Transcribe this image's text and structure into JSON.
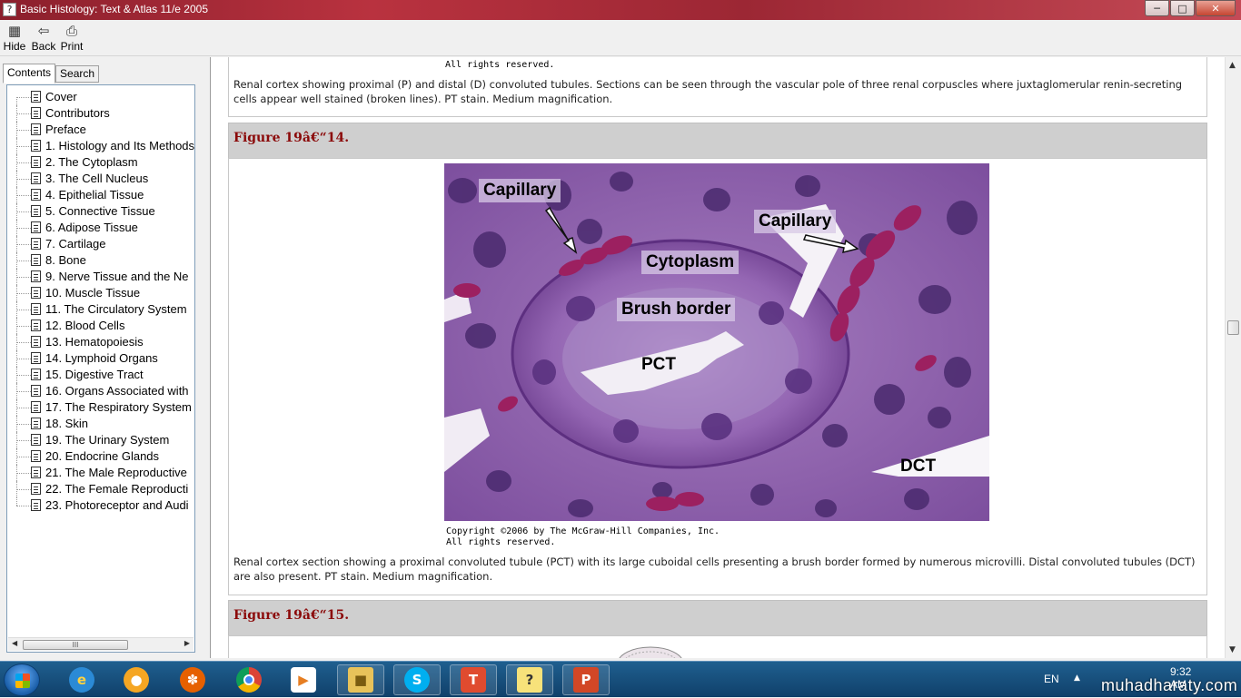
{
  "window": {
    "title": "Basic Histology: Text & Atlas 11/e 2005",
    "buttons": {
      "minimize": "─",
      "maximize": "□",
      "close": "✕"
    }
  },
  "toolbar": {
    "hide_label": "Hide",
    "back_label": "Back",
    "print_label": "Print"
  },
  "nav": {
    "tabs": [
      "Contents",
      "Search"
    ],
    "items": [
      "Cover",
      "Contributors",
      "Preface",
      "1. Histology and Its Methods",
      "2. The Cytoplasm",
      "3. The Cell Nucleus",
      "4. Epithelial Tissue",
      "5. Connective Tissue",
      "6. Adipose Tissue",
      "7. Cartilage",
      "8. Bone",
      "9. Nerve Tissue and the Ne",
      "10. Muscle Tissue",
      "11. The Circulatory System",
      "12. Blood Cells",
      "13. Hematopoiesis",
      "14. Lymphoid Organs",
      "15. Digestive Tract",
      "16. Organs Associated with",
      "17. The Respiratory System",
      "18. Skin",
      "19. The Urinary System",
      "20. Endocrine Glands",
      "21. The Male Reproductive",
      "22. The Female Reproducti",
      "23. Photoreceptor and Audi"
    ],
    "scroll_thumb": "III"
  },
  "content": {
    "prev_figure": {
      "copyright_line2": "All rights reserved.",
      "caption": "Renal cortex showing proximal (P) and distal (D) convoluted tubules. Sections can be seen through the vascular pole of three renal corpuscles where juxtaglomerular renin-secreting cells appear well stained (broken lines). PT stain. Medium magnification."
    },
    "figure_14": {
      "heading": "Figure 19â€“14.",
      "image_labels": {
        "capillary_left": "Capillary",
        "capillary_right": "Capillary",
        "cytoplasm": "Cytoplasm",
        "brush_border": "Brush border",
        "pct": "PCT",
        "dct": "DCT"
      },
      "copyright_line1": "Copyright ©2006 by The McGraw-Hill Companies, Inc.",
      "copyright_line2": "All rights reserved.",
      "caption": "Renal cortex section showing a proximal convoluted tubule (PCT) with its large cuboidal cells presenting a brush border formed by numerous microvilli. Distal convoluted tubules (DCT) are also present. PT stain. Medium magnification."
    },
    "figure_15": {
      "heading": "Figure 19â€“15."
    }
  },
  "taskbar": {
    "apps": [
      "internet-explorer",
      "media-center",
      "firefox",
      "chrome",
      "media-player",
      "file-explorer",
      "skype",
      "t-app",
      "help-viewer",
      "powerpoint"
    ],
    "language": "EN",
    "time": "9:32 AM",
    "watermark": "muhadharaty.com"
  },
  "colors": {
    "title_bar": "#a52a36",
    "figure_heading_text": "#8b0a0a",
    "figure_heading_bg": "#cfcfcf",
    "stain_purple": "#8a5aa8"
  }
}
